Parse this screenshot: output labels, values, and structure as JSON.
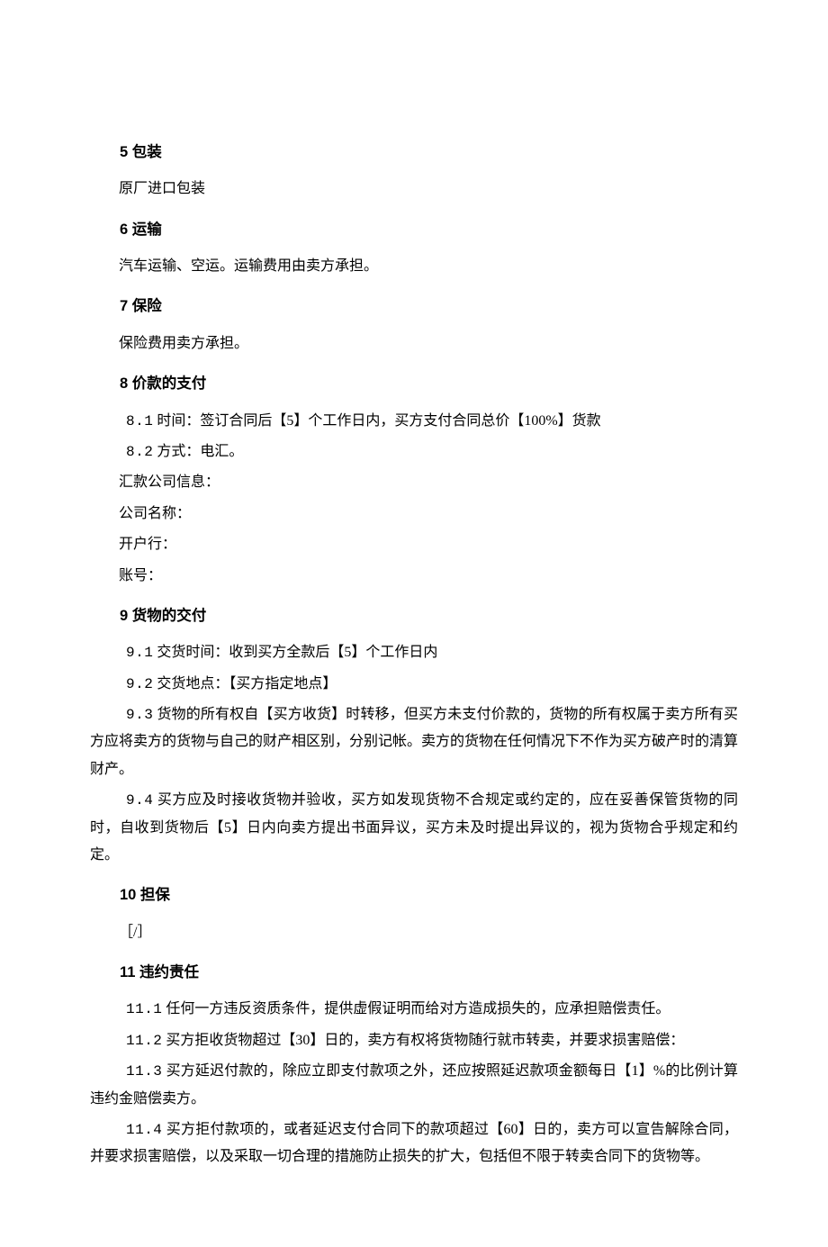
{
  "s5": {
    "heading": "5 包装",
    "p1": "原厂进口包装"
  },
  "s6": {
    "heading": "6 运输",
    "p1": "汽车运输、空运。运输费用由卖方承担。"
  },
  "s7": {
    "heading": "7 保险",
    "p1": "保险费用卖方承担。"
  },
  "s8": {
    "heading": "8 价款的支付",
    "c1_num": "8.1",
    "c1_text": "  时间：签订合同后【5】个工作日内，买方支付合同总价【100%】货款",
    "c2_num": "8.2",
    "c2_text": "  方式：电汇。",
    "p3": "汇款公司信息：",
    "p4": "公司名称：",
    "p5": "开户行：",
    "p6": "账号："
  },
  "s9": {
    "heading": "9 货物的交付",
    "c1_num": "9.1",
    "c1_text": "  交货时间：收到买方全款后【5】个工作日内",
    "c2_num": "9.2",
    "c2_text": "  交货地点：【买方指定地点】",
    "c3_num": "9.3",
    "c3_text": "  货物的所有权自【买方收货】时转移，但买方未支付价款的，货物的所有权属于卖方所有买方应将卖方的货物与自己的财产相区别，分别记帐。卖方的货物在任何情况下不作为买方破产时的清算财产。",
    "c4_num": "9.4",
    "c4_text": "  买方应及时接收货物并验收，买方如发现货物不合规定或约定的，应在妥善保管货物的同时，自收到货物后【5】日内向卖方提出书面异议，买方未及时提出异议的，视为货物合乎规定和约定。"
  },
  "s10": {
    "heading": "10 担保",
    "p1": "［/］"
  },
  "s11": {
    "heading": "11 违约责任",
    "c1_num": "11.1",
    "c1_text": "  任何一方违反资质条件，提供虚假证明而给对方造成损失的，应承担赔偿责任。",
    "c2_num": "11.2",
    "c2_text": "  买方拒收货物超过【30】日的，卖方有权将货物随行就市转卖，并要求损害赔偿：",
    "c3_num": "11.3",
    "c3_text": "  买方延迟付款的，除应立即支付款项之外，还应按照延迟款项金额每日【1】%的比例计算违约金赔偿卖方。",
    "c4_num": "11.4",
    "c4_text": "  买方拒付款项的，或者延迟支付合同下的款项超过【60】日的，卖方可以宣告解除合同，并要求损害赔偿，以及采取一切合理的措施防止损失的扩大，包括但不限于转卖合同下的货物等。"
  }
}
